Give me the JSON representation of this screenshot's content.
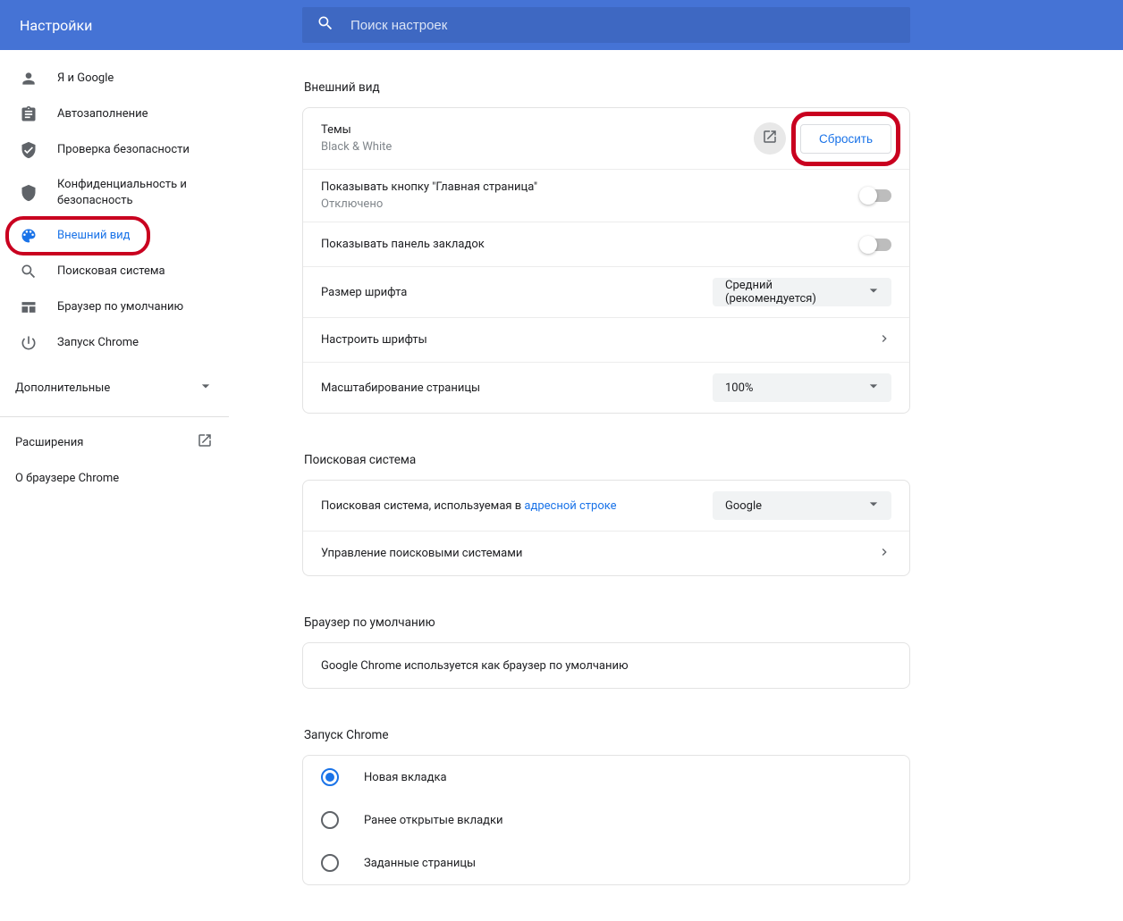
{
  "header": {
    "title": "Настройки",
    "search_placeholder": "Поиск настроек"
  },
  "sidebar": {
    "items": [
      {
        "id": "you-and-google",
        "label": "Я и Google"
      },
      {
        "id": "autofill",
        "label": "Автозаполнение"
      },
      {
        "id": "safety-check",
        "label": "Проверка безопасности"
      },
      {
        "id": "privacy-security",
        "label": "Конфиденциальность и безопасность"
      },
      {
        "id": "appearance",
        "label": "Внешний вид"
      },
      {
        "id": "search-engine",
        "label": "Поисковая система"
      },
      {
        "id": "default-browser",
        "label": "Браузер по умолчанию"
      },
      {
        "id": "on-startup",
        "label": "Запуск Chrome"
      }
    ],
    "advanced_label": "Дополнительные",
    "extensions_label": "Расширения",
    "about_label": "О браузере Chrome"
  },
  "appearance": {
    "section_title": "Внешний вид",
    "theme_label": "Темы",
    "theme_value": "Black & White",
    "reset_button": "Сбросить",
    "home_button_label": "Показывать кнопку \"Главная страница\"",
    "home_button_status": "Отключено",
    "bookmarks_bar_label": "Показывать панель закладок",
    "font_size_label": "Размер шрифта",
    "font_size_value": "Средний (рекомендуется)",
    "customize_fonts_label": "Настроить шрифты",
    "zoom_label": "Масштабирование страницы",
    "zoom_value": "100%"
  },
  "search": {
    "section_title": "Поисковая система",
    "main_label_prefix": "Поисковая система, используемая в ",
    "main_label_link": "адресной строке",
    "engine_value": "Google",
    "manage_label": "Управление поисковыми системами"
  },
  "default_browser": {
    "section_title": "Браузер по умолчанию",
    "status_text": "Google Chrome используется как браузер по умолчанию"
  },
  "startup": {
    "section_title": "Запуск Chrome",
    "options": [
      {
        "label": "Новая вкладка",
        "checked": true
      },
      {
        "label": "Ранее открытые вкладки",
        "checked": false
      },
      {
        "label": "Заданные страницы",
        "checked": false
      }
    ]
  }
}
